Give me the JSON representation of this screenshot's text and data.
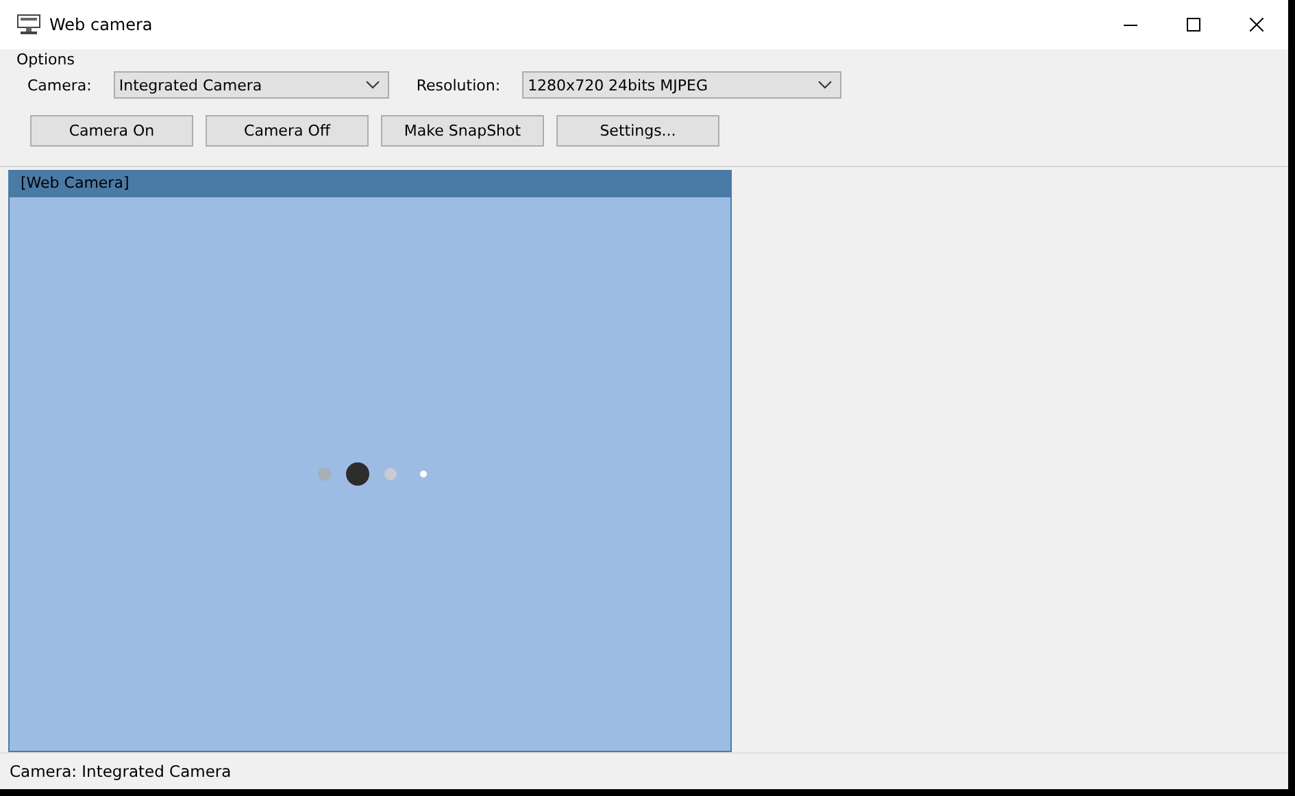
{
  "window": {
    "title": "Web camera"
  },
  "options": {
    "title": "Options",
    "fields": [
      {
        "label": "Camera:",
        "value": "Integrated Camera"
      },
      {
        "label": "Resolution:",
        "value": "1280x720 24bits MJPEG"
      }
    ],
    "buttons": [
      "Camera On",
      "Camera Off",
      "Make SnapShot",
      "Settings..."
    ]
  },
  "preview": {
    "title": "[Web Camera]"
  },
  "status_bar": "Camera: Integrated Camera"
}
